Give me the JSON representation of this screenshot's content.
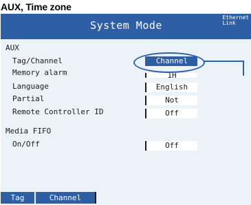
{
  "caption": "AUX, Time zone",
  "screen": {
    "title": "System Mode",
    "status_line1": "Ethernet",
    "status_line2": "Link"
  },
  "groups": {
    "aux": {
      "heading": "AUX",
      "rows": [
        {
          "label": "Tag/Channel",
          "value": "Channel",
          "selected": true
        },
        {
          "label": "Memory alarm",
          "value": "1H"
        },
        {
          "label": "Language",
          "value": "English"
        },
        {
          "label": "Partial",
          "value": "Not"
        },
        {
          "label": "Remote Controller ID",
          "value": "Off"
        }
      ]
    },
    "media": {
      "heading": "Media FIFO",
      "rows": [
        {
          "label": "On/Off",
          "value": "Off"
        }
      ]
    }
  },
  "softkeys": [
    {
      "label": "Tag"
    },
    {
      "label": "Channel"
    }
  ],
  "colors": {
    "accent": "#2e5ea3",
    "background": "#ebf3f9",
    "text": "#1b1b1b"
  }
}
